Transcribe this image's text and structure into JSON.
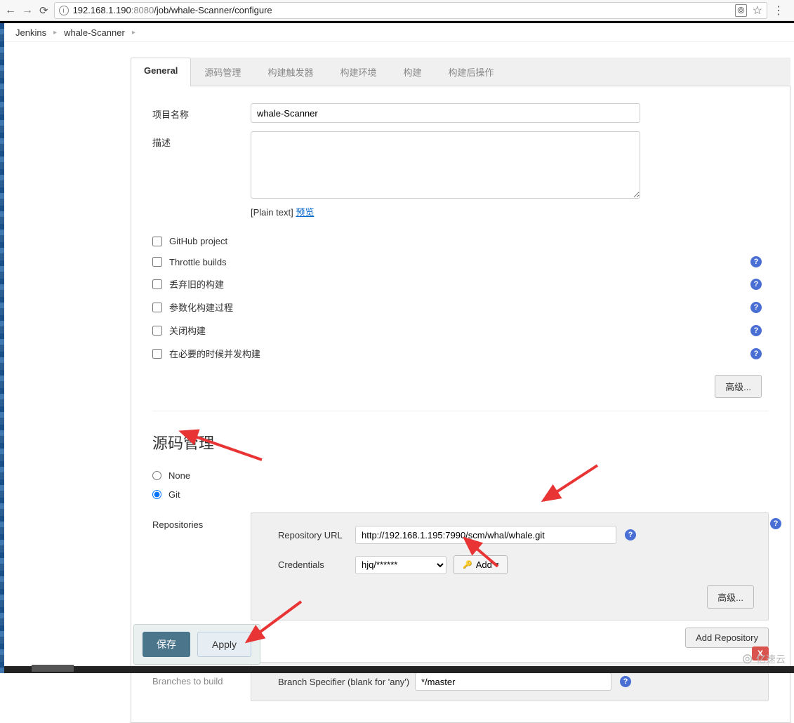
{
  "browser": {
    "url_host": "192.168.1.190",
    "url_port": ":8080",
    "url_path": "/job/whale-Scanner/configure"
  },
  "breadcrumb": {
    "items": [
      "Jenkins",
      "whale-Scanner"
    ]
  },
  "tabs": [
    "General",
    "源码管理",
    "构建触发器",
    "构建环境",
    "构建",
    "构建后操作"
  ],
  "general": {
    "name_label": "项目名称",
    "name_value": "whale-Scanner",
    "desc_label": "描述",
    "desc_value": "",
    "plain_text": "[Plain text]",
    "preview_link": "预览",
    "checkboxes": [
      {
        "label": "GitHub project",
        "help": false
      },
      {
        "label": "Throttle builds",
        "help": true
      },
      {
        "label": "丢弃旧的构建",
        "help": true
      },
      {
        "label": "参数化构建过程",
        "help": true
      },
      {
        "label": "关闭构建",
        "help": true
      },
      {
        "label": "在必要的时候并发构建",
        "help": true
      }
    ],
    "advanced_btn": "高级..."
  },
  "scm": {
    "heading": "源码管理",
    "radio_none": "None",
    "radio_git": "Git",
    "repositories_label": "Repositories",
    "repo_url_label": "Repository URL",
    "repo_url_value": "http://192.168.1.195:7990/scm/whal/whale.git",
    "credentials_label": "Credentials",
    "credentials_value": "hjq/******",
    "add_btn": "Add",
    "advanced_btn": "高级...",
    "add_repo_btn": "Add Repository",
    "branches_label": "Branches to build",
    "branch_spec_label": "Branch Specifier (blank for 'any')",
    "branch_spec_value": "*/master",
    "delete_x": "X"
  },
  "footer": {
    "save": "保存",
    "apply": "Apply"
  },
  "watermark": "亿速云"
}
